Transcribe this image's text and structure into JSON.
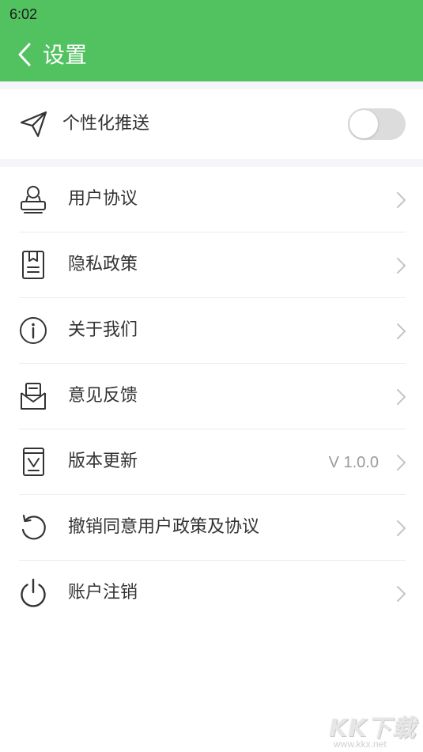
{
  "status_bar": {
    "time": "6:02"
  },
  "header": {
    "title": "设置",
    "back_icon": "chevron-left-icon"
  },
  "colors": {
    "accent": "#52c160",
    "toggle_off": "#dcdcdc",
    "section_gap": "#f6f5fb"
  },
  "push_setting": {
    "label": "个性化推送",
    "icon": "send-icon",
    "enabled": false
  },
  "menu": {
    "items": [
      {
        "label": "用户协议",
        "icon": "user-agreement-icon",
        "value": ""
      },
      {
        "label": "隐私政策",
        "icon": "privacy-document-icon",
        "value": ""
      },
      {
        "label": "关于我们",
        "icon": "info-icon",
        "value": ""
      },
      {
        "label": "意见反馈",
        "icon": "feedback-mail-icon",
        "value": ""
      },
      {
        "label": "版本更新",
        "icon": "version-update-icon",
        "value": "V 1.0.0"
      },
      {
        "label": "撤销同意用户政策及协议",
        "icon": "revoke-icon",
        "value": ""
      },
      {
        "label": "账户注销",
        "icon": "power-icon",
        "value": ""
      }
    ]
  },
  "watermark": {
    "logo": "KK下载",
    "url": "www.kkx.net"
  }
}
